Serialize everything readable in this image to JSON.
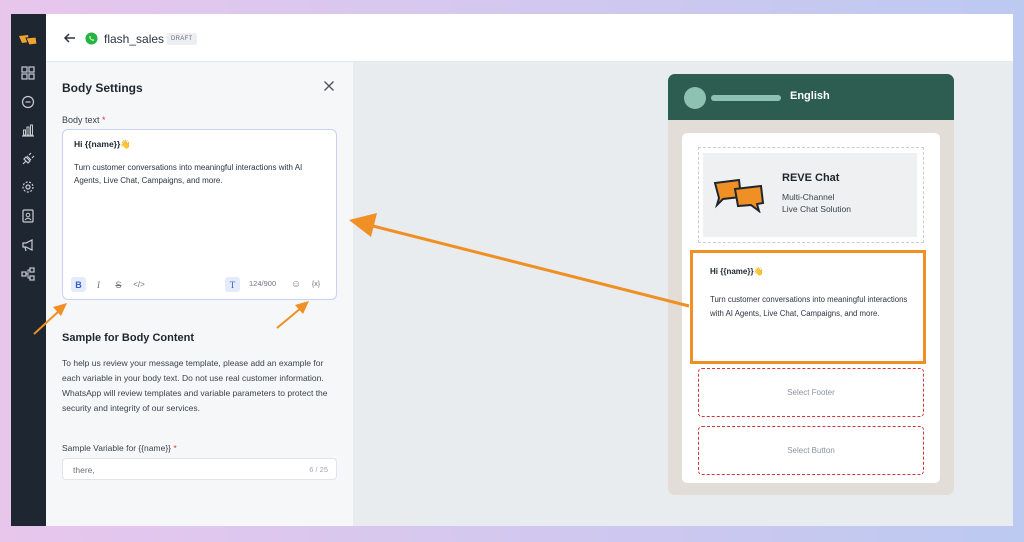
{
  "topbar": {
    "template_name": "flash_sales",
    "status_badge": "DRAFT"
  },
  "settings": {
    "title": "Body Settings",
    "body_text_label": "Body text",
    "required_mark": "*",
    "editor": {
      "greeting": "Hi {{name}}👋",
      "body": "Turn customer conversations into meaningful interactions with AI Agents, Live Chat, Campaigns, and more.",
      "char_count": "124/900"
    },
    "toolbar": {
      "bold": "B",
      "italic": "I",
      "strike": "S",
      "code": "</>",
      "text_format": "T",
      "emoji": "☺",
      "variable": "{x}"
    },
    "sample_title": "Sample for Body Content",
    "sample_desc": "To help us review your message template, please add an example for each variable in your body text. Do not use real customer information. WhatsApp will review templates and variable parameters to protect the security and integrity of our services.",
    "sample_var_label": "Sample Variable for {{name}}",
    "sample_var_value": "there,",
    "sample_var_count": "6 / 25"
  },
  "preview": {
    "language": "English",
    "brand_name": "REVE Chat",
    "brand_tagline_1": "Multi-Channel",
    "brand_tagline_2": "Live Chat Solution",
    "body_greeting": "Hi {{name}}👋",
    "body_text": "Turn customer conversations into meaningful interactions with AI Agents, Live Chat, Campaigns, and more.",
    "footer_placeholder": "Select Footer",
    "button_placeholder": "Select Button"
  },
  "colors": {
    "sidebar": "#1d2631",
    "whatsapp_header": "#2d5d51",
    "highlight": "#ef8f24",
    "required": "#e0383e"
  },
  "icons": [
    "logo-icon",
    "grid-icon",
    "chat-icon",
    "chart-icon",
    "plug-icon",
    "gear-icon",
    "contacts-icon",
    "megaphone-icon",
    "flow-icon",
    "back-arrow-icon",
    "whatsapp-icon",
    "close-icon"
  ]
}
